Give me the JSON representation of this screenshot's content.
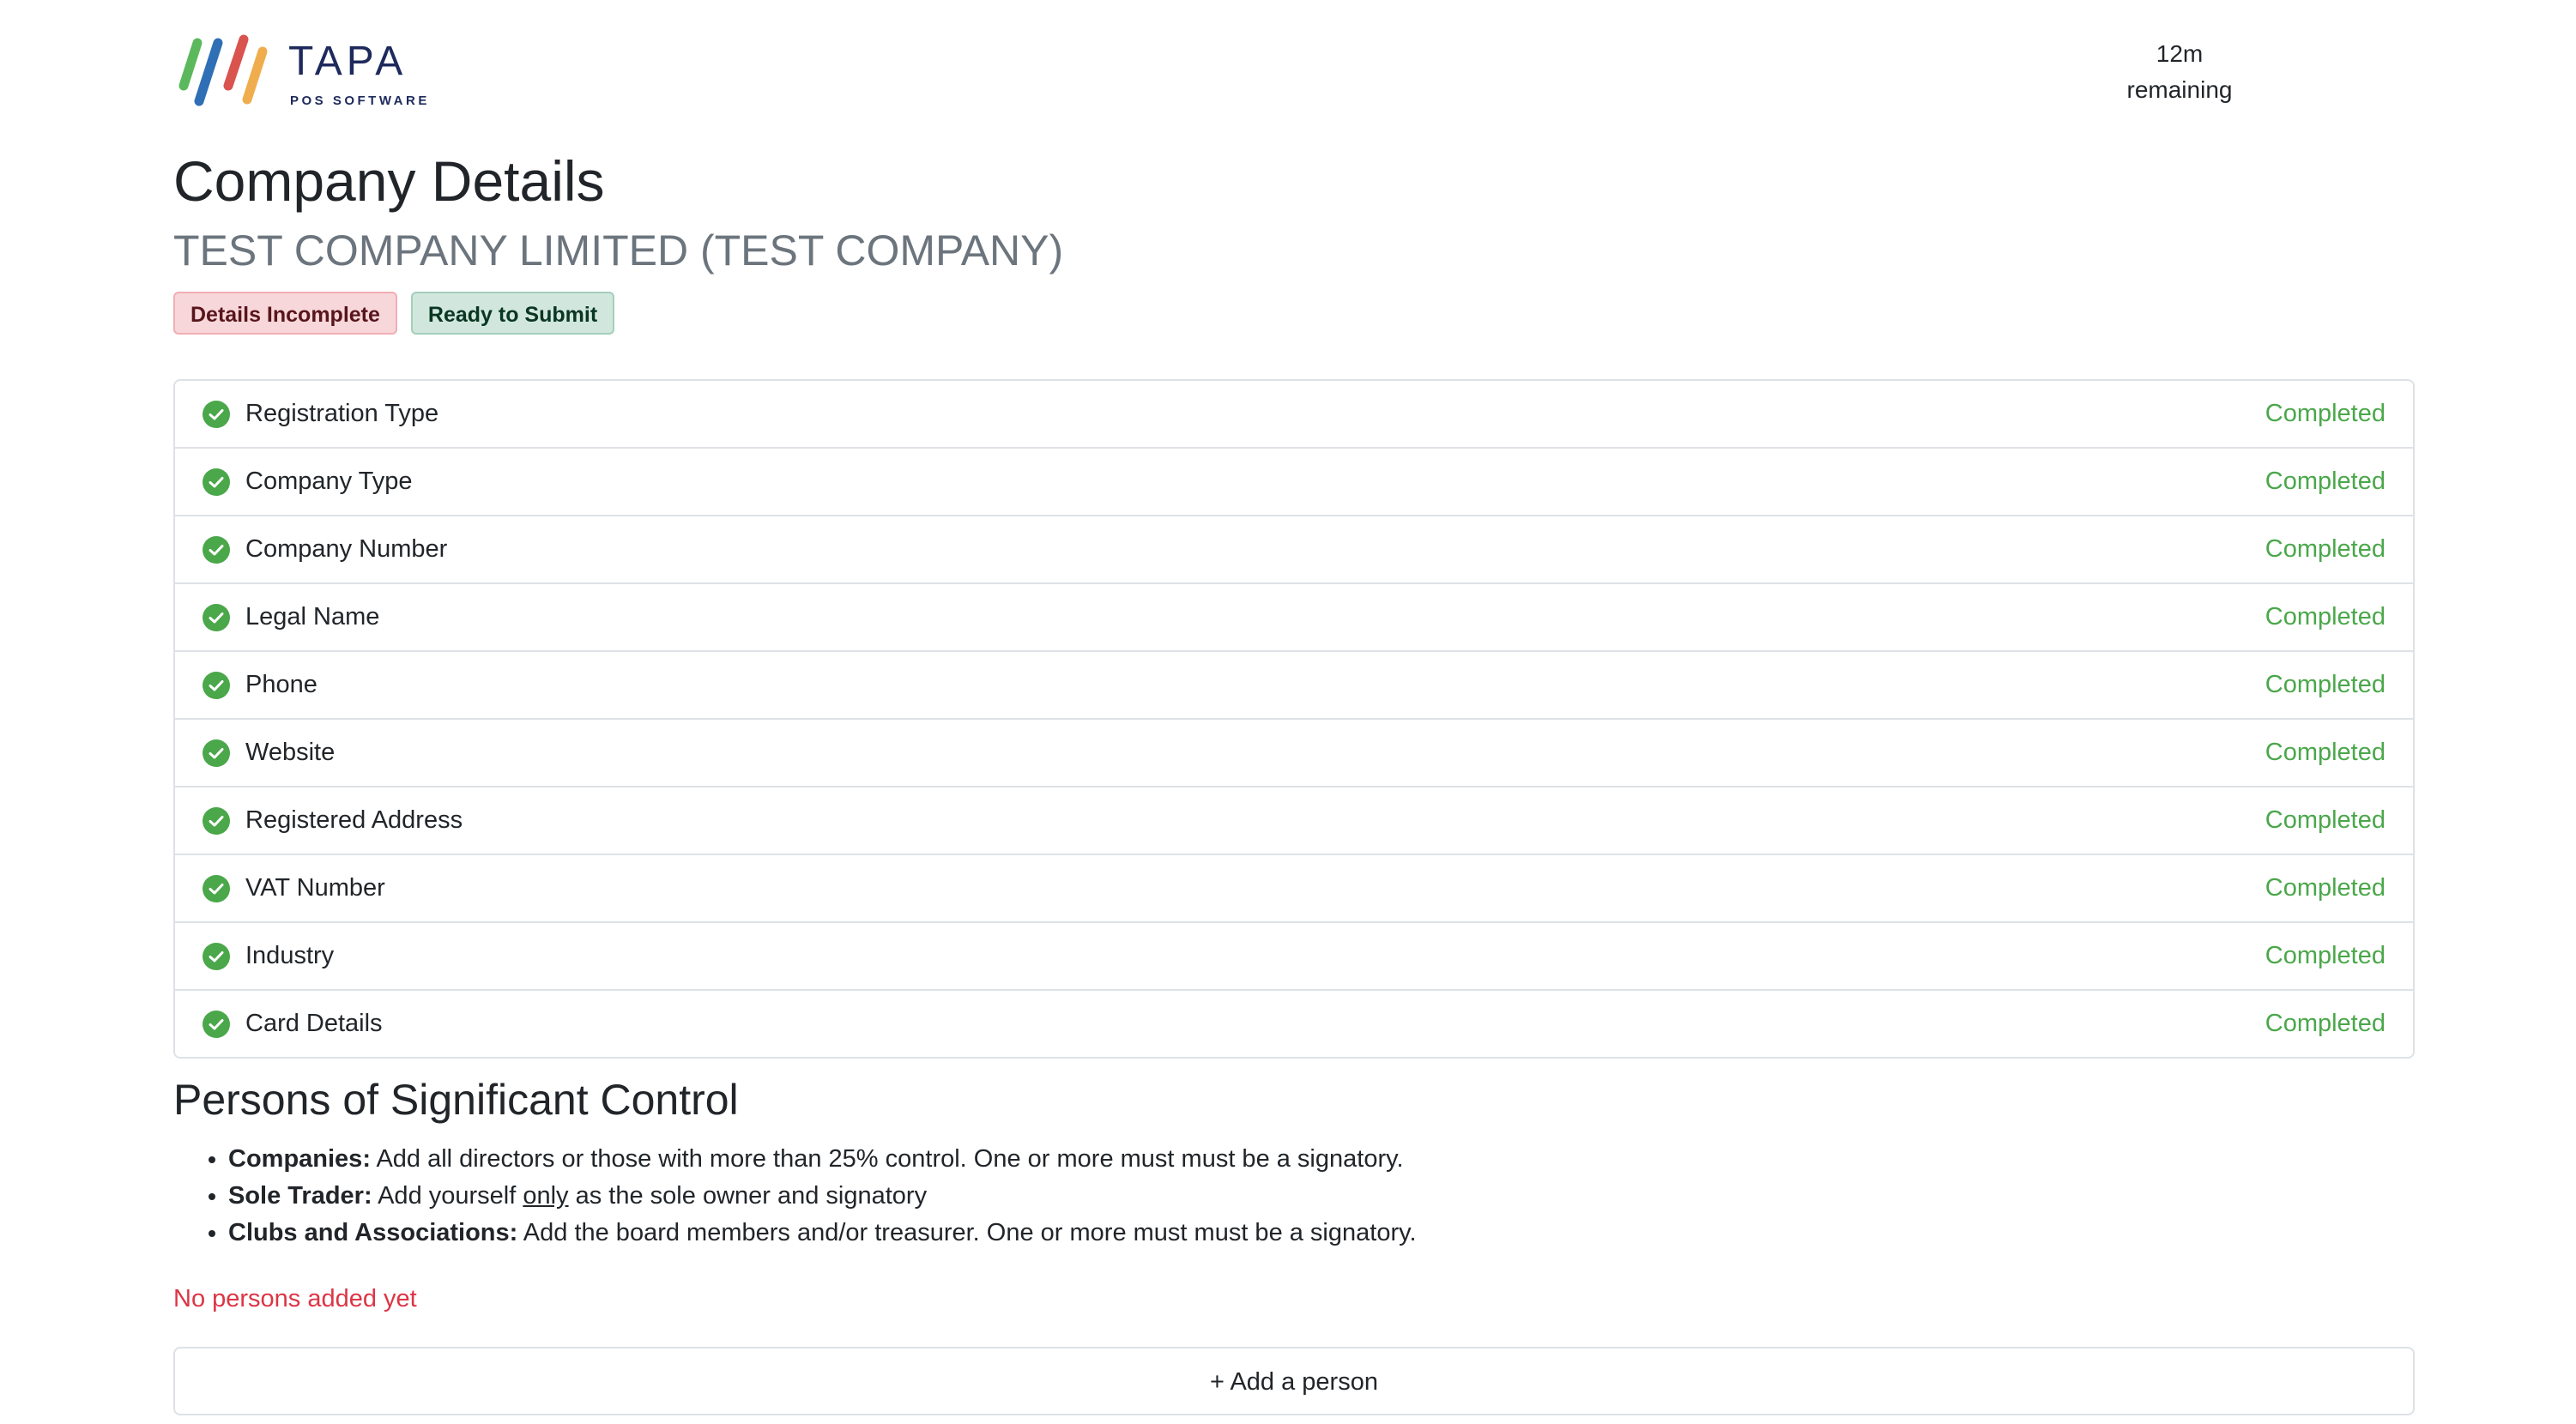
{
  "header": {
    "logo": {
      "word": "TAPA",
      "sub": "POS SOFTWARE",
      "stripe_colors": [
        "#5cb85c",
        "#2f6fb5",
        "#d9534f",
        "#f0ad4e"
      ]
    },
    "timer": {
      "value": "12m",
      "label": "remaining"
    }
  },
  "main": {
    "title": "Company Details",
    "company_name": "TEST COMPANY LIMITED (TEST COMPANY)",
    "badges": [
      {
        "label": "Details Incomplete",
        "variant": "danger"
      },
      {
        "label": "Ready to Submit",
        "variant": "success"
      }
    ],
    "checklist": [
      {
        "label": "Registration Type",
        "status": "Completed",
        "icon": "check-circle-icon"
      },
      {
        "label": "Company Type",
        "status": "Completed",
        "icon": "check-circle-icon"
      },
      {
        "label": "Company Number",
        "status": "Completed",
        "icon": "check-circle-icon"
      },
      {
        "label": "Legal Name",
        "status": "Completed",
        "icon": "check-circle-icon"
      },
      {
        "label": "Phone",
        "status": "Completed",
        "icon": "check-circle-icon"
      },
      {
        "label": "Website",
        "status": "Completed",
        "icon": "check-circle-icon"
      },
      {
        "label": "Registered Address",
        "status": "Completed",
        "icon": "check-circle-icon"
      },
      {
        "label": "VAT Number",
        "status": "Completed",
        "icon": "check-circle-icon"
      },
      {
        "label": "Industry",
        "status": "Completed",
        "icon": "check-circle-icon"
      },
      {
        "label": "Card Details",
        "status": "Completed",
        "icon": "check-circle-icon"
      }
    ]
  },
  "psc": {
    "heading": "Persons of Significant Control",
    "rules": [
      {
        "term": "Companies:",
        "text": "Add all directors or those with more than 25% control. One or more must must be a signatory."
      },
      {
        "term": "Sole Trader:",
        "text_before": "Add yourself",
        "underlined": "only",
        "text_after": "as the sole owner and signatory"
      },
      {
        "term": "Clubs and Associations:",
        "text": "Add the board members and/or treasurer. One or more must must be a signatory."
      }
    ],
    "empty_message": "No persons added yet",
    "add_button_label": "+ Add a person"
  },
  "colors": {
    "completed": "#4aa74a",
    "danger_text": "#dc3545",
    "check_icon_fill": "#4aa74a"
  }
}
